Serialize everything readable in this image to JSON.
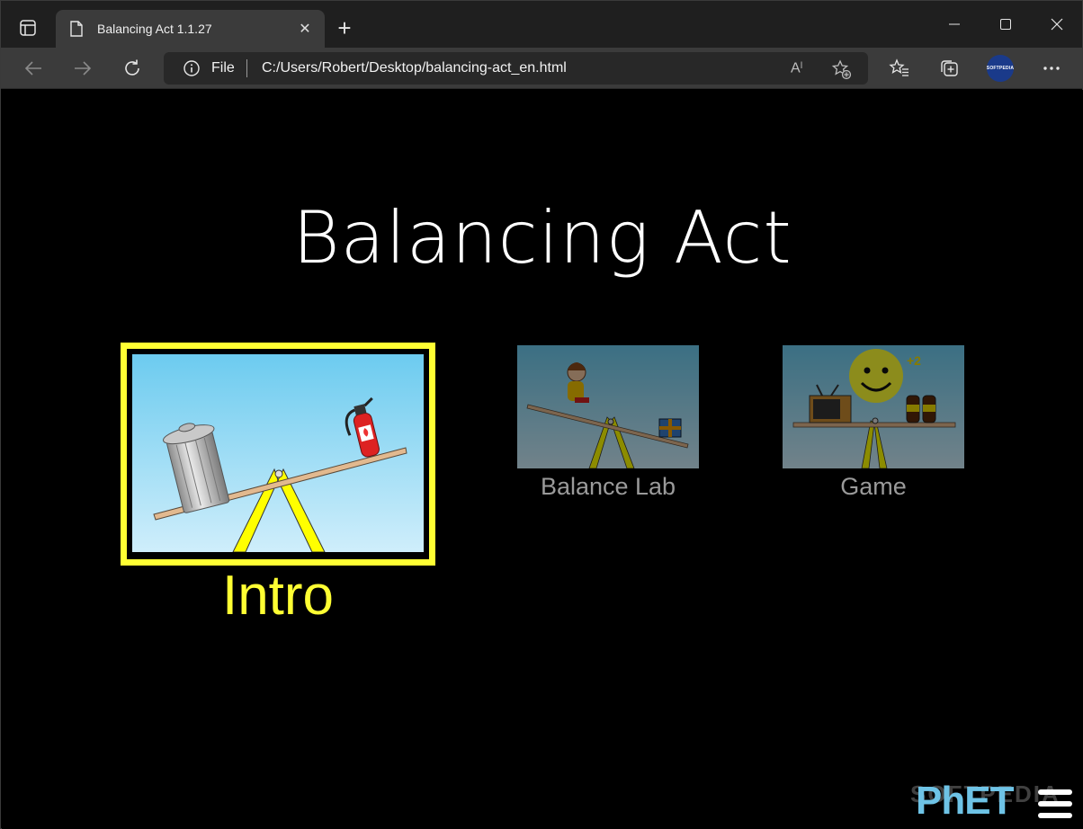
{
  "browser": {
    "tab_title": "Balancing Act 1.1.27",
    "tab_close": "✕",
    "new_tab": "+",
    "address_scheme": "File",
    "address_url": "C:/Users/Robert/Desktop/balancing-act_en.html",
    "read_aloud": "A)",
    "profile_label": "SOFTPEDIA"
  },
  "sim": {
    "title": "Balancing Act",
    "screens": [
      {
        "label": "Intro",
        "selected": true
      },
      {
        "label": "Balance Lab",
        "selected": false
      },
      {
        "label": "Game",
        "selected": false
      }
    ],
    "game_thumb_badge": "+2",
    "logo": "PhET",
    "watermark": "SOFTPEDIA"
  },
  "colors": {
    "selected": "#ffff33",
    "sky_top": "#6ccbef",
    "sky_bottom": "#cfeefb",
    "fulcrum": "#ffff00",
    "plank": "#e2b98f"
  }
}
